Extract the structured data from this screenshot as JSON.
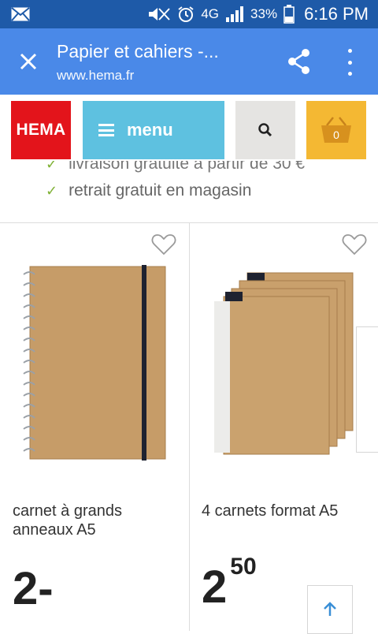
{
  "status_bar": {
    "network": "4G",
    "battery": "33%",
    "time": "6:16 PM"
  },
  "tab_bar": {
    "title": "Papier et cahiers -...",
    "url": "www.hema.fr",
    "close_icon": "close-icon",
    "share_icon": "share-icon",
    "more_icon": "more-vert-icon"
  },
  "header": {
    "logo": "HEMA",
    "menu_label": "menu",
    "cart_count": "0",
    "colors": {
      "logo": "#e3141b",
      "menu": "#5ec1e0",
      "search": "#e5e4e2",
      "cart": "#f4b833"
    }
  },
  "benefits": {
    "partial": "livraison gratuite à partir de 30 €",
    "items": [
      "retrait gratuit en magasin"
    ]
  },
  "products": [
    {
      "name": "carnet à grands anneaux A5",
      "price_main": "2",
      "price_cents": "-"
    },
    {
      "name": "4 carnets format A5",
      "price_main": "2",
      "price_cents": "50"
    }
  ]
}
